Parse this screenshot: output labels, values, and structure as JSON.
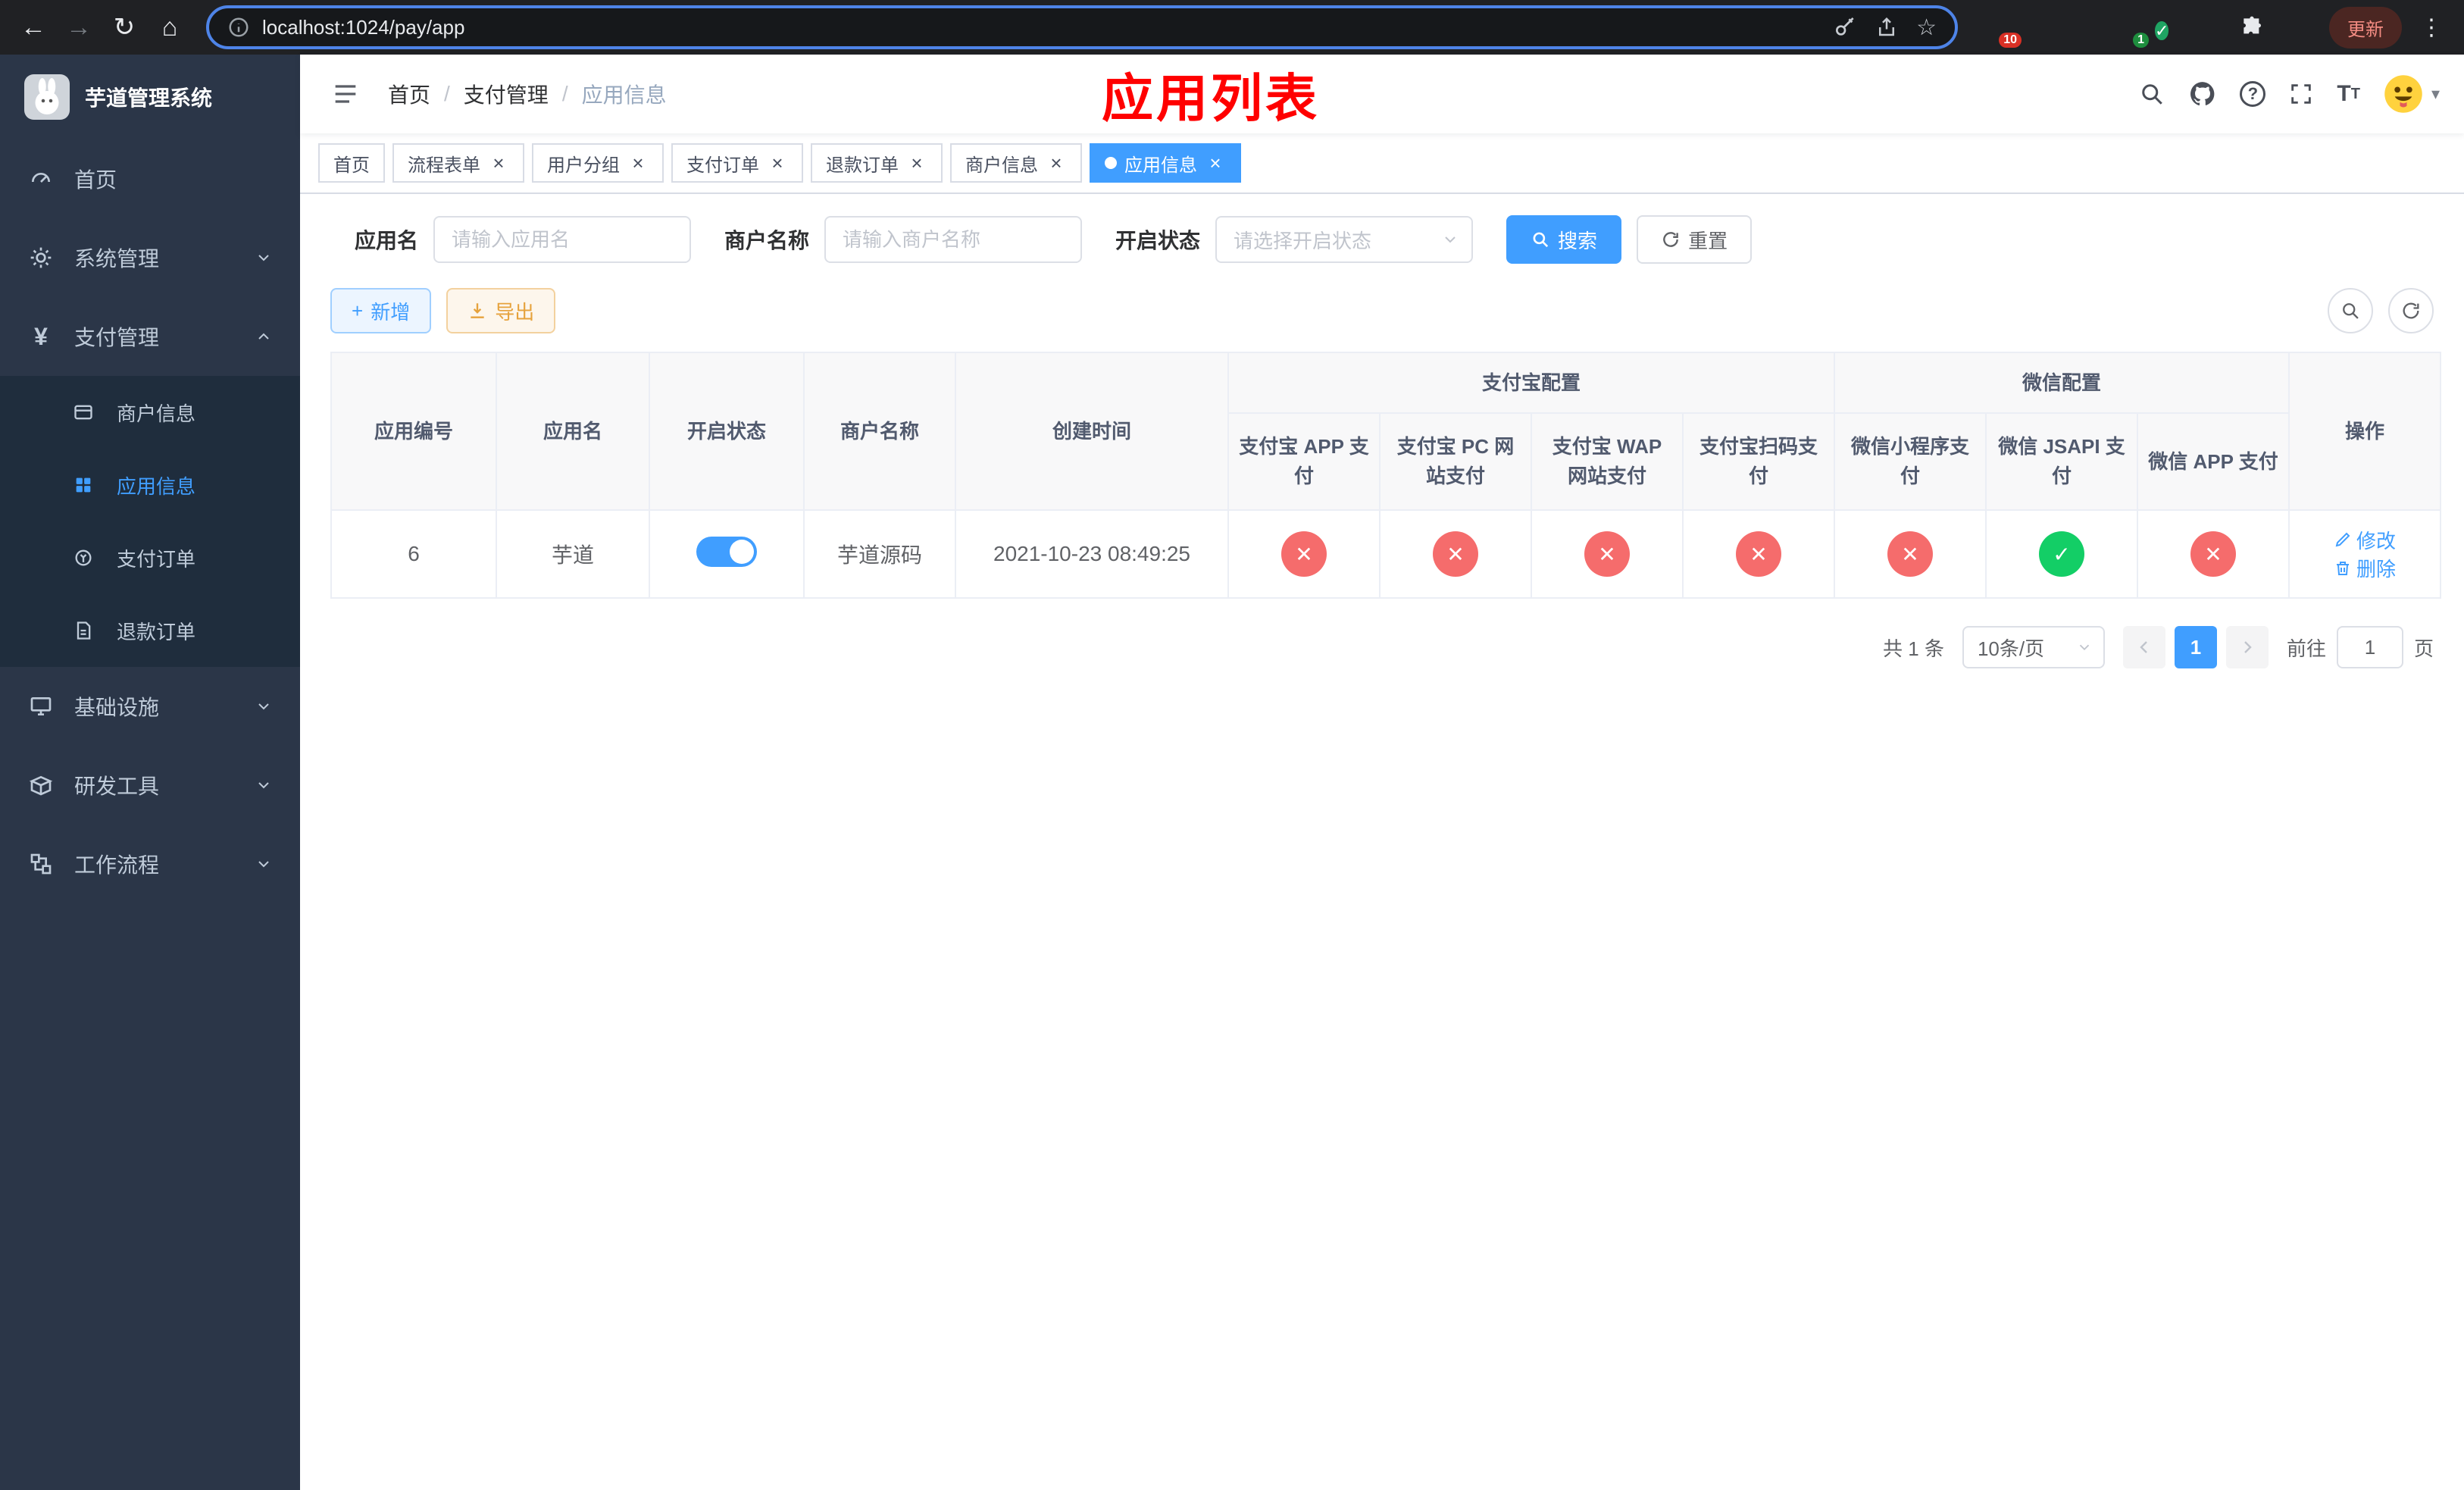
{
  "browser": {
    "url": "localhost:1024/pay/app",
    "update_label": "更新",
    "extension_badges": {
      "red": "10",
      "green": "1"
    }
  },
  "icons": {
    "back": "←",
    "forward": "→",
    "refresh": "↻",
    "home": "⌂",
    "star": "☆",
    "kebab": "⋮",
    "caret": "▾",
    "close": "×",
    "question": "?",
    "plus": "+",
    "yen": "¥",
    "check": "✓",
    "cross": "✕",
    "slash": "/"
  },
  "sidebar": {
    "logo_title": "芋道管理系统",
    "menu": {
      "home": "首页",
      "system": "系统管理",
      "payment": "支付管理",
      "infrastructure": "基础设施",
      "dev_tools": "研发工具",
      "workflow": "工作流程"
    },
    "payment_children": {
      "merchant_info": "商户信息",
      "app_info": "应用信息",
      "pay_order": "支付订单",
      "refund_order": "退款订单"
    }
  },
  "navbar": {
    "breadcrumb": {
      "home": "首页",
      "section": "支付管理",
      "current": "应用信息"
    },
    "page_title": "应用列表"
  },
  "tabs": [
    {
      "label": "首页",
      "closable": false,
      "active": false
    },
    {
      "label": "流程表单",
      "closable": true,
      "active": false
    },
    {
      "label": "用户分组",
      "closable": true,
      "active": false
    },
    {
      "label": "支付订单",
      "closable": true,
      "active": false
    },
    {
      "label": "退款订单",
      "closable": true,
      "active": false
    },
    {
      "label": "商户信息",
      "closable": true,
      "active": false
    },
    {
      "label": "应用信息",
      "closable": true,
      "active": true
    }
  ],
  "filters": {
    "app_name_label": "应用名",
    "app_name_placeholder": "请输入应用名",
    "merchant_label": "商户名称",
    "merchant_placeholder": "请输入商户名称",
    "status_label": "开启状态",
    "status_placeholder": "请选择开启状态",
    "search_label": "搜索",
    "reset_label": "重置"
  },
  "toolbar": {
    "add_label": "新增",
    "export_label": "导出"
  },
  "table": {
    "headers": {
      "app_id": "应用编号",
      "app_name": "应用名",
      "open_status": "开启状态",
      "merchant_name": "商户名称",
      "create_time": "创建时间",
      "alipay_group": "支付宝配置",
      "wechat_group": "微信配置",
      "actions": "操作"
    },
    "alipay_columns": [
      "支付宝 APP 支付",
      "支付宝 PC 网站支付",
      "支付宝 WAP 网站支付",
      "支付宝扫码支付"
    ],
    "wechat_columns": [
      "微信小程序支付",
      "微信 JSAPI 支付",
      "微信 APP 支付"
    ],
    "rows": [
      {
        "app_id": "6",
        "app_name": "芋道",
        "enabled": true,
        "merchant_name": "芋道源码",
        "create_time": "2021-10-23 08:49:25",
        "pay_status": [
          false,
          false,
          false,
          false,
          false,
          true,
          false
        ],
        "edit_label": "修改",
        "delete_label": "删除"
      }
    ]
  },
  "pagination": {
    "total_text": "共 1 条",
    "page_size_text": "10条/页",
    "current_page": "1",
    "goto_prefix": "前往",
    "goto_value": "1",
    "goto_suffix": "页"
  },
  "colors": {
    "primary": "#409eff",
    "success": "#13ce66",
    "danger": "#f56c6c",
    "warning_text": "#e6a23c",
    "title_red": "#ff0000",
    "sidebar_bg": "#2b3648",
    "submenu_bg": "#1f2d3d"
  }
}
